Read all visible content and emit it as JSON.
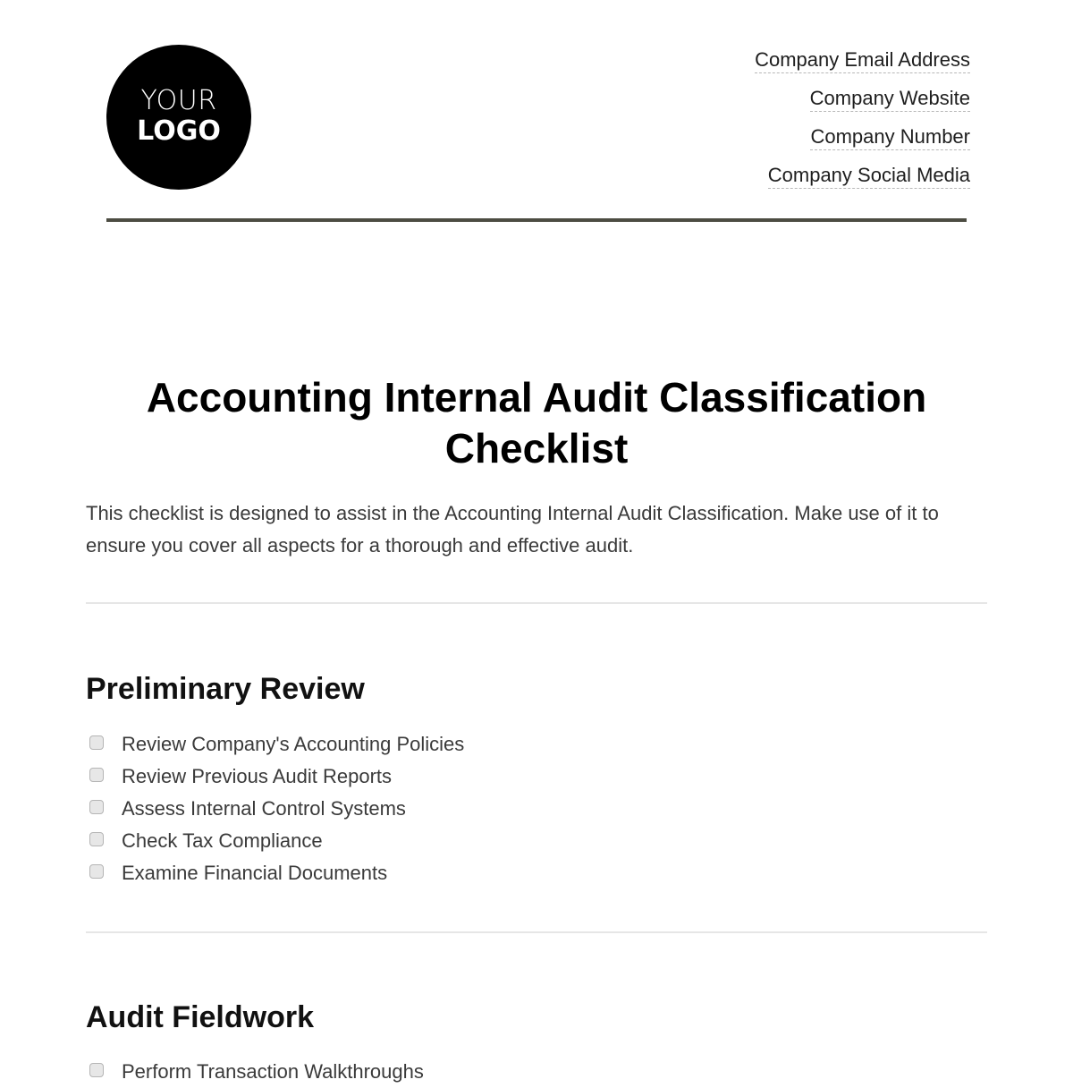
{
  "header": {
    "logo": {
      "line1": "YOUR",
      "line2": "LOGO"
    },
    "contacts": [
      "Company Email Address",
      "Company Website",
      "Company Number",
      "Company Social Media"
    ]
  },
  "document": {
    "title": "Accounting Internal Audit Classification Checklist",
    "intro": "This checklist is designed to assist in the Accounting Internal Audit Classification. Make use of it to ensure you cover all aspects for a thorough and effective audit."
  },
  "sections": [
    {
      "title": "Preliminary Review",
      "items": [
        {
          "label": "Review Company's Accounting Policies",
          "checked": false
        },
        {
          "label": "Review Previous Audit Reports",
          "checked": false
        },
        {
          "label": "Assess Internal Control Systems",
          "checked": false
        },
        {
          "label": "Check Tax Compliance",
          "checked": false
        },
        {
          "label": "Examine Financial Documents",
          "checked": false
        }
      ]
    },
    {
      "title": "Audit Fieldwork",
      "items": [
        {
          "label": "Perform Transaction Walkthroughs",
          "checked": false
        }
      ]
    }
  ],
  "colors": {
    "header_rule": "#4c4c42",
    "divider": "#e6e6e6",
    "logo_bg": "#000000"
  }
}
